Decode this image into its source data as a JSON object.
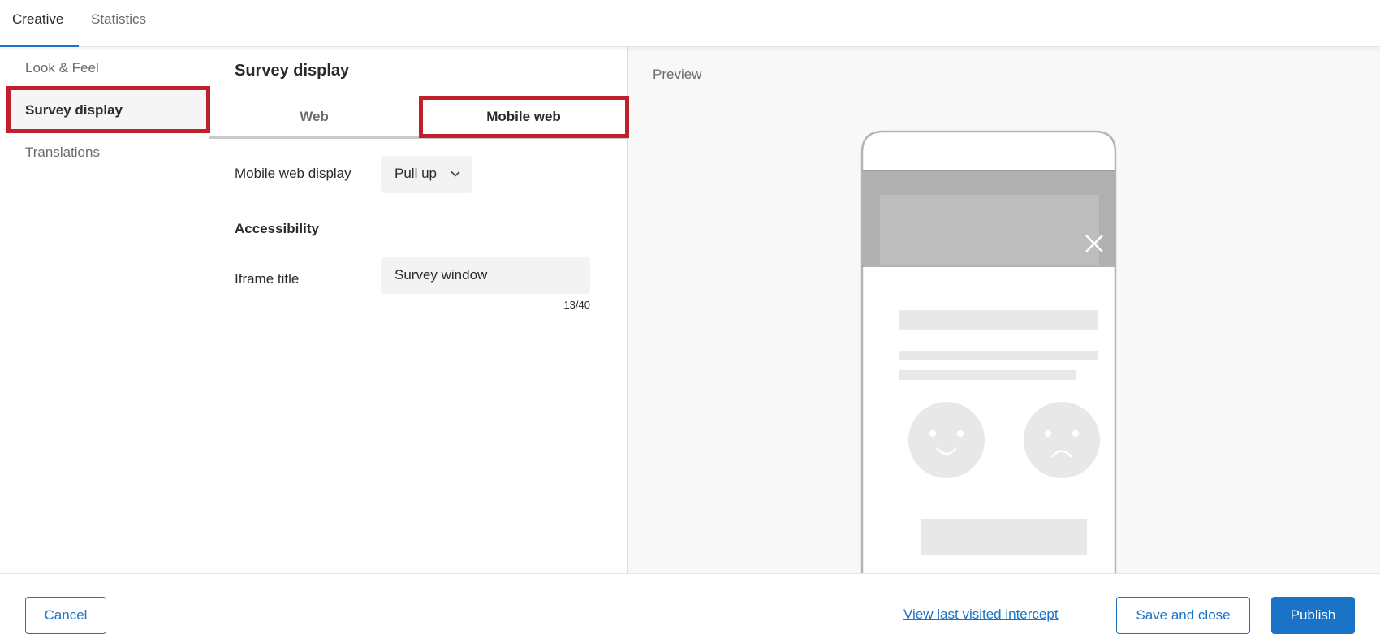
{
  "top_tabs": [
    {
      "label": "Creative",
      "active": true
    },
    {
      "label": "Statistics",
      "active": false
    }
  ],
  "sidebar": {
    "items": [
      {
        "label": "Look & Feel",
        "active": false
      },
      {
        "label": "Survey display",
        "active": true
      },
      {
        "label": "Translations",
        "active": false
      }
    ]
  },
  "panel": {
    "title": "Survey display",
    "sub_tabs": [
      {
        "label": "Web",
        "active": false
      },
      {
        "label": "Mobile web",
        "active": true
      }
    ],
    "mobile_display_label": "Mobile web display",
    "mobile_display_value": "Pull up",
    "accessibility_heading": "Accessibility",
    "iframe_title_label": "Iframe title",
    "iframe_title_value": "Survey window",
    "iframe_title_counter": "13/40"
  },
  "preview": {
    "label": "Preview"
  },
  "footer": {
    "cancel_label": "Cancel",
    "view_last_label": "View last visited intercept",
    "save_close_label": "Save and close",
    "publish_label": "Publish"
  },
  "colors": {
    "accent": "#1a73c7",
    "highlight": "#c0202e"
  },
  "icons": {
    "dropdown": "chevron-down-icon",
    "close": "close-icon"
  }
}
